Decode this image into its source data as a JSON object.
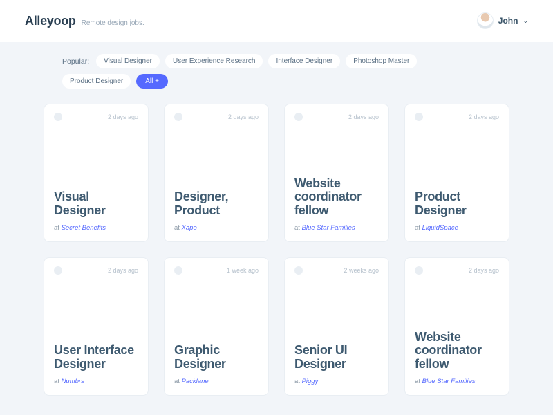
{
  "header": {
    "logo": "Alleyoop",
    "tagline": "Remote design jobs.",
    "user_name": "John"
  },
  "filters": {
    "label": "Popular:",
    "items": [
      {
        "label": "Visual Designer",
        "active": false
      },
      {
        "label": "User Experience Research",
        "active": false
      },
      {
        "label": "Interface Designer",
        "active": false
      },
      {
        "label": "Photoshop Master",
        "active": false
      },
      {
        "label": "Product Designer",
        "active": false
      },
      {
        "label": "All +",
        "active": true
      }
    ]
  },
  "jobs": [
    {
      "date": "2 days ago",
      "title": "Visual Designer",
      "at": "at ",
      "company": "Secret Benefits"
    },
    {
      "date": "2 days ago",
      "title": "Designer, Product",
      "at": "at ",
      "company": "Xapo"
    },
    {
      "date": "2 days ago",
      "title": "Website coordinator fellow",
      "at": "at ",
      "company": "Blue Star Families"
    },
    {
      "date": "2 days ago",
      "title": "Product Designer",
      "at": "at ",
      "company": "LiquidSpace"
    },
    {
      "date": "2 days ago",
      "title": "User Interface Designer",
      "at": "at ",
      "company": "Numbrs"
    },
    {
      "date": "1 week ago",
      "title": "Graphic Designer",
      "at": "at ",
      "company": "Packlane"
    },
    {
      "date": "2 weeks ago",
      "title": "Senior UI Designer",
      "at": "at ",
      "company": "Piggy"
    },
    {
      "date": "2 days ago",
      "title": "Website coordinator fellow",
      "at": "at ",
      "company": "Blue Star Families"
    }
  ]
}
